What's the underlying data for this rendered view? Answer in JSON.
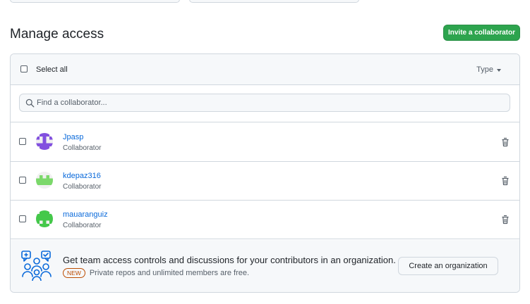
{
  "header": {
    "title": "Manage access",
    "invite_label": "Invite a collaborator"
  },
  "toolbar": {
    "select_all_label": "Select all",
    "type_filter_label": "Type"
  },
  "search": {
    "placeholder": "Find a collaborator..."
  },
  "collaborators": [
    {
      "name": "Jpasp",
      "role": "Collaborator",
      "avatar_color": "#8250df"
    },
    {
      "name": "kdepaz316",
      "role": "Collaborator",
      "avatar_color": "#7bd86a"
    },
    {
      "name": "mauaranguiz",
      "role": "Collaborator",
      "avatar_color": "#44c84a"
    }
  ],
  "org_banner": {
    "title": "Get team access controls and discussions for your contributors in an organization.",
    "badge": "NEW",
    "subtitle": "Private repos and unlimited members are free.",
    "button_label": "Create an organization"
  },
  "colors": {
    "primary_button": "#2da44e",
    "link": "#0969da",
    "badge": "#bc4c00",
    "border": "#d0d7de"
  }
}
